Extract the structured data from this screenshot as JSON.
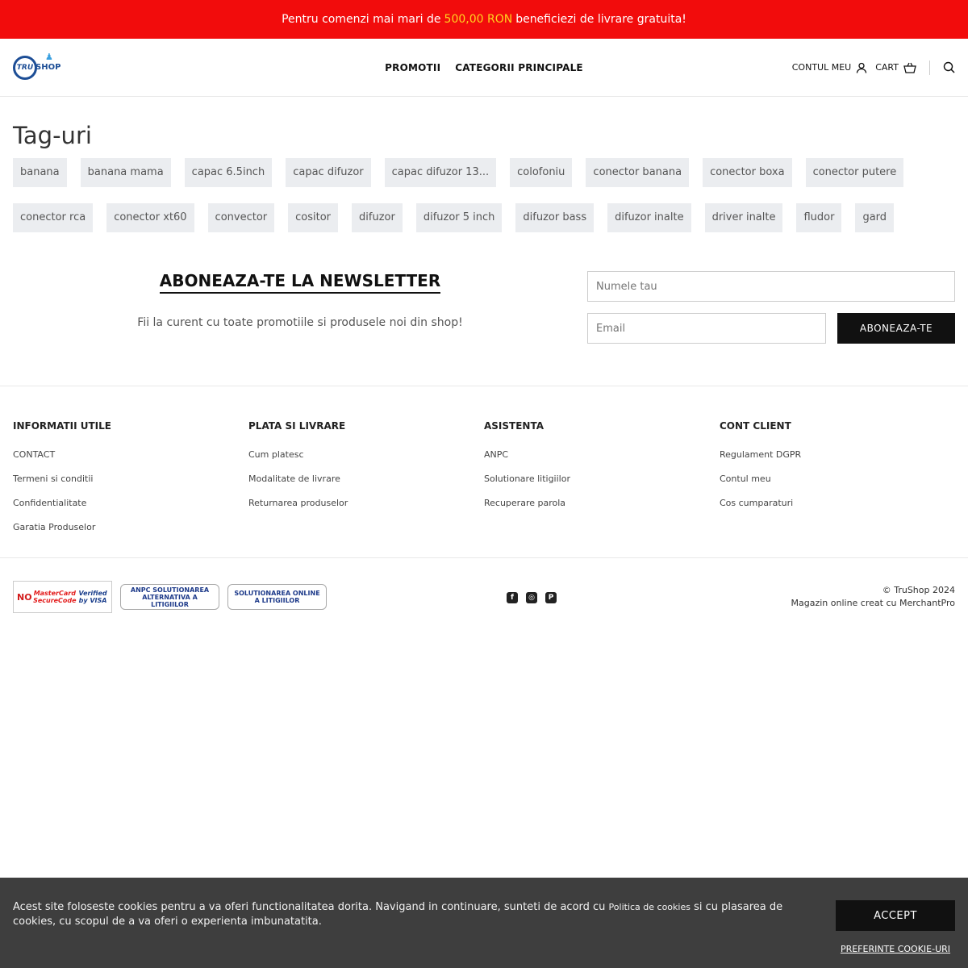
{
  "promo": {
    "pre": "Pentru comenzi mai mari de",
    "amount": "500,00 RON",
    "post": "beneficiezi de livrare gratuita!"
  },
  "header": {
    "logo_tru": "TRU",
    "logo_shop": "SHOP",
    "nav": [
      "PROMOTII",
      "CATEGORII PRINCIPALE"
    ],
    "account_label": "CONTUL MEU",
    "cart_label": "CART"
  },
  "page": {
    "title": "Tag-uri",
    "tags": [
      "banana",
      "banana mama",
      "capac 6.5inch",
      "capac difuzor",
      "capac difuzor 13...",
      "colofoniu",
      "conector banana",
      "conector boxa",
      "conector putere",
      "conector rca",
      "conector xt60",
      "convector",
      "cositor",
      "difuzor",
      "difuzor 5 inch",
      "difuzor bass",
      "difuzor inalte",
      "driver inalte",
      "fludor",
      "gard"
    ]
  },
  "newsletter": {
    "title": "ABONEAZA-TE LA NEWSLETTER",
    "subtitle": "Fii la curent cu toate promotiile si produsele noi din shop!",
    "name_placeholder": "Numele tau",
    "email_placeholder": "Email",
    "button": "ABONEAZA-TE"
  },
  "footer": {
    "columns": [
      {
        "title": "INFORMATII UTILE",
        "links": [
          "CONTACT",
          "Termeni si conditii",
          "Confidentialitate",
          "Garatia Produselor"
        ]
      },
      {
        "title": "PLATA SI LIVRARE",
        "links": [
          "Cum platesc",
          "Modalitate de livrare",
          "Returnarea produselor"
        ]
      },
      {
        "title": "ASISTENTA",
        "links": [
          "ANPC",
          "Solutionare litigiilor",
          "Recuperare parola"
        ]
      },
      {
        "title": "CONT CLIENT",
        "links": [
          "Regulament DGPR",
          "Contul meu",
          "Cos cumparaturi"
        ]
      }
    ],
    "badges": {
      "cards": [
        "NO",
        "MasterCard SecureCode",
        "Verified by VISA"
      ],
      "anpc": "ANPC SOLUTIONAREA ALTERNATIVA A LITIGIILOR",
      "sol": "SOLUTIONAREA ONLINE A LITIGIILOR"
    },
    "copyright": "© TruShop 2024",
    "powered": "Magazin online creat cu MerchantPro"
  },
  "cookie": {
    "text_pre": "Acest site foloseste cookies pentru a va oferi functionalitatea dorita. Navigand in continuare, sunteti de acord cu",
    "policy_link": "Politica de cookies",
    "text_post": "si cu plasarea de cookies, cu scopul de a va oferi o experienta imbunatatita.",
    "accept": "ACCEPT",
    "preferences": "PREFERINTE COOKIE-URI"
  }
}
